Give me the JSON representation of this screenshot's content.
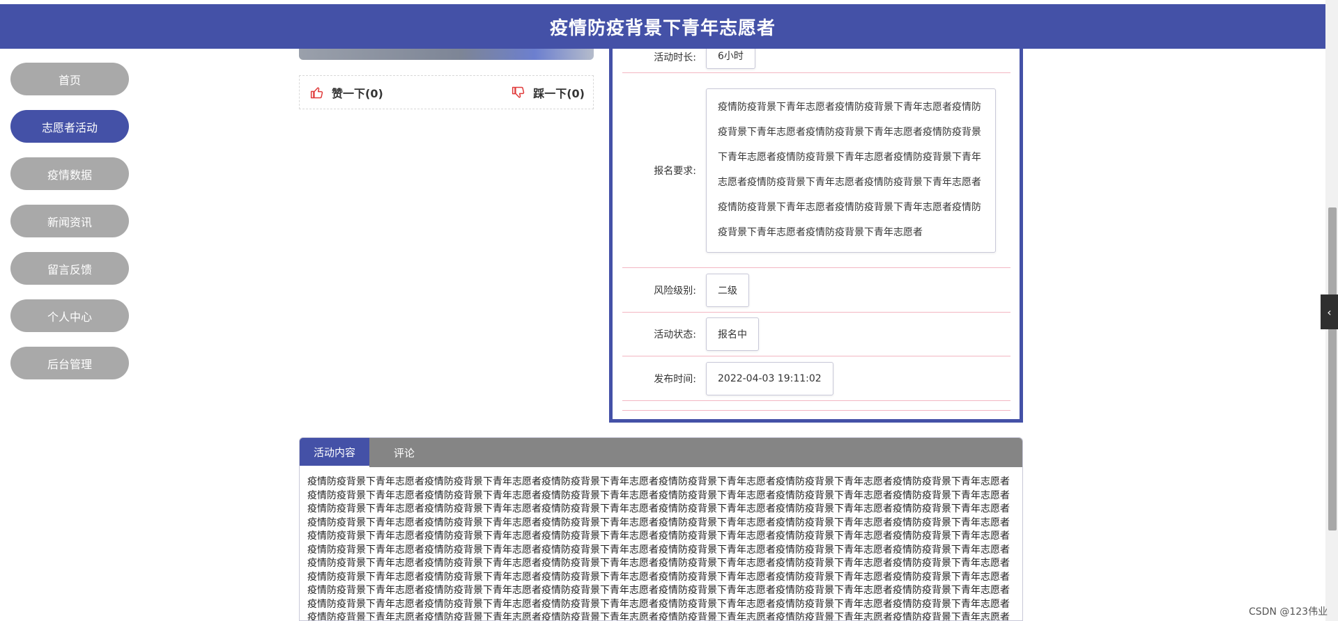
{
  "header": {
    "title": "疫情防疫背景下青年志愿者"
  },
  "nav": {
    "items": [
      {
        "label": "首页",
        "active": false
      },
      {
        "label": "志愿者活动",
        "active": true
      },
      {
        "label": "疫情数据",
        "active": false
      },
      {
        "label": "新闻资讯",
        "active": false
      },
      {
        "label": "留言反馈",
        "active": false
      },
      {
        "label": "个人中心",
        "active": false
      },
      {
        "label": "后台管理",
        "active": false
      }
    ]
  },
  "votes": {
    "like_label": "赞一下(0)",
    "dislike_label": "踩一下(0)",
    "like_icon": "thumbs-up-icon",
    "dislike_icon": "thumbs-down-icon"
  },
  "details": {
    "duration_label": "活动时长:",
    "duration_value": "6小时",
    "requirement_label": "报名要求:",
    "requirement_value": "疫情防疫背景下青年志愿者疫情防疫背景下青年志愿者疫情防疫背景下青年志愿者疫情防疫背景下青年志愿者疫情防疫背景下青年志愿者疫情防疫背景下青年志愿者疫情防疫背景下青年志愿者疫情防疫背景下青年志愿者疫情防疫背景下青年志愿者疫情防疫背景下青年志愿者疫情防疫背景下青年志愿者疫情防疫背景下青年志愿者疫情防疫背景下青年志愿者",
    "risk_label": "风险级别:",
    "risk_value": "二级",
    "status_label": "活动状态:",
    "status_value": "报名中",
    "publish_label": "发布时间:",
    "publish_value": "2022-04-03 19:11:02"
  },
  "tabs": {
    "items": [
      {
        "label": "活动内容",
        "active": true
      },
      {
        "label": "评论",
        "active": false
      }
    ],
    "content": "疫情防疫背景下青年志愿者疫情防疫背景下青年志愿者疫情防疫背景下青年志愿者疫情防疫背景下青年志愿者疫情防疫背景下青年志愿者疫情防疫背景下青年志愿者疫情防疫背景下青年志愿者疫情防疫背景下青年志愿者疫情防疫背景下青年志愿者疫情防疫背景下青年志愿者疫情防疫背景下青年志愿者疫情防疫背景下青年志愿者疫情防疫背景下青年志愿者疫情防疫背景下青年志愿者疫情防疫背景下青年志愿者疫情防疫背景下青年志愿者疫情防疫背景下青年志愿者疫情防疫背景下青年志愿者疫情防疫背景下青年志愿者疫情防疫背景下青年志愿者疫情防疫背景下青年志愿者疫情防疫背景下青年志愿者疫情防疫背景下青年志愿者疫情防疫背景下青年志愿者疫情防疫背景下青年志愿者疫情防疫背景下青年志愿者疫情防疫背景下青年志愿者疫情防疫背景下青年志愿者疫情防疫背景下青年志愿者疫情防疫背景下青年志愿者疫情防疫背景下青年志愿者疫情防疫背景下青年志愿者疫情防疫背景下青年志愿者疫情防疫背景下青年志愿者疫情防疫背景下青年志愿者疫情防疫背景下青年志愿者疫情防疫背景下青年志愿者疫情防疫背景下青年志愿者疫情防疫背景下青年志愿者疫情防疫背景下青年志愿者疫情防疫背景下青年志愿者疫情防疫背景下青年志愿者疫情防疫背景下青年志愿者疫情防疫背景下青年志愿者疫情防疫背景下青年志愿者疫情防疫背景下青年志愿者疫情防疫背景下青年志愿者疫情防疫背景下青年志愿者疫情防疫背景下青年志愿者疫情防疫背景下青年志愿者疫情防疫背景下青年志愿者疫情防疫背景下青年志愿者疫情防疫背景下青年志愿者疫情防疫背景下青年志愿者疫情防疫背景下青年志愿者疫情防疫背景下青年志愿者疫情防疫背景下青年志愿者疫情防疫背景下青年志愿者疫情防疫背景下青年志愿者疫情防疫背景下青年志愿者疫情防疫背景下青年志愿者疫情防疫背景下青年志愿者疫情防疫背景下青年志愿者疫情防疫背景下青年志愿者疫情防疫背景下青年志愿者疫情防疫背景下青年志愿者疫情防疫背景下青年志愿者疫情防疫背景下青年志愿者疫情防疫背景下青年志愿者疫情防疫背景下青年志愿者疫情防疫背景下青年志愿者疫情防疫背景下青年志愿者疫情防疫背景下青年志愿者疫情防疫背景下青年志愿者疫情防疫背景下青年志愿者疫情防疫背景下青年志愿者疫情防疫背景下青年志愿者疫情防疫背景下青年志愿者疫情防疫背景下青年志愿者疫情防疫背景下青年志愿者"
  },
  "side_toggle": {
    "icon": "chevron-left-icon",
    "glyph": "‹"
  },
  "watermark": "CSDN @123伟业",
  "colors": {
    "primary": "#4451a7",
    "nav_inactive": "#a9a9a9",
    "tab_bar": "#858585",
    "divider": "#f3b6c2"
  }
}
